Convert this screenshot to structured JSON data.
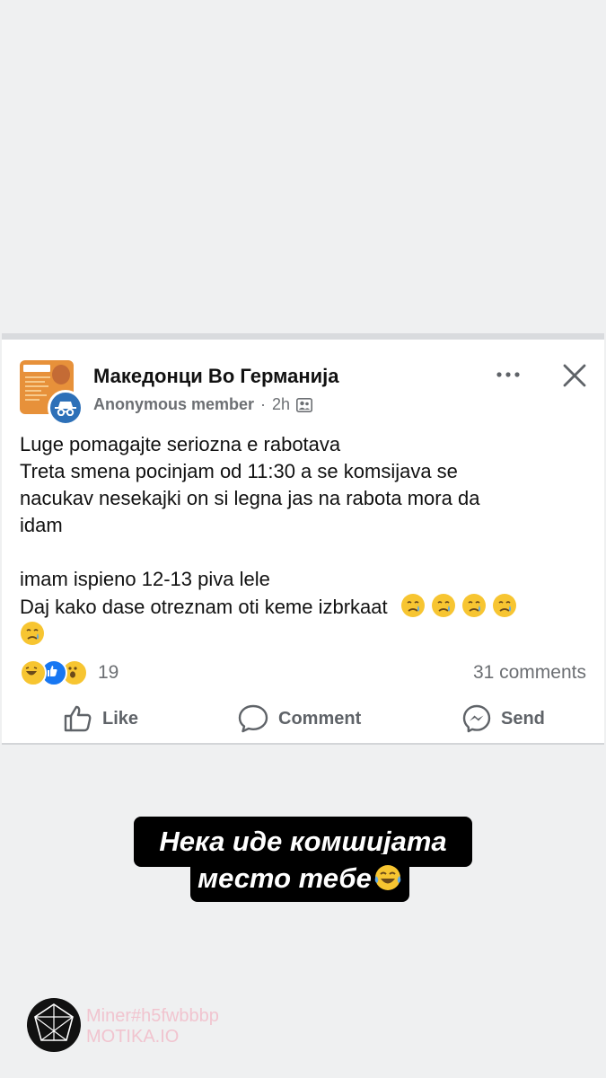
{
  "post": {
    "group_name": "Македонци Во Германија",
    "author": "Anonymous member",
    "separator": "·",
    "time": "2h",
    "text_lines": [
      "Luge pomagajte seriozna e rabotava",
      "Treta smena pocinjam od 11:30  a se komsijava se",
      "nacukav nesekajki on si legna jas na rabota mora da",
      "idam",
      "imam ispieno 12-13 piva lele",
      "Daj kako dase otreznam oti keme izbrkaat"
    ],
    "trailing_emojis": [
      "crying-face",
      "crying-face",
      "crying-face",
      "crying-face",
      "crying-face"
    ],
    "reaction_count": "19",
    "reaction_types": [
      "haha",
      "like",
      "wow"
    ],
    "comments_count": "31 comments"
  },
  "actions": {
    "like": "Like",
    "comment": "Comment",
    "send": "Send"
  },
  "icons": {
    "more": "more-options-icon",
    "close": "close-icon",
    "audience": "group-audience-icon",
    "anonymous": "incognito-icon"
  },
  "caption": {
    "line1": "Нека иде комшијата",
    "line2": "место тебе",
    "emoji": "tears-of-joy"
  },
  "watermark": {
    "line1": "Miner#h5fwbbbp",
    "line2": "MOTIKA.IO"
  },
  "colors": {
    "background": "#eff0f1",
    "like_blue": "#1877f2",
    "anon_badge": "#2d70b8",
    "emoji_yellow": "#f7c531",
    "watermark_pink": "#f1c4cf"
  }
}
